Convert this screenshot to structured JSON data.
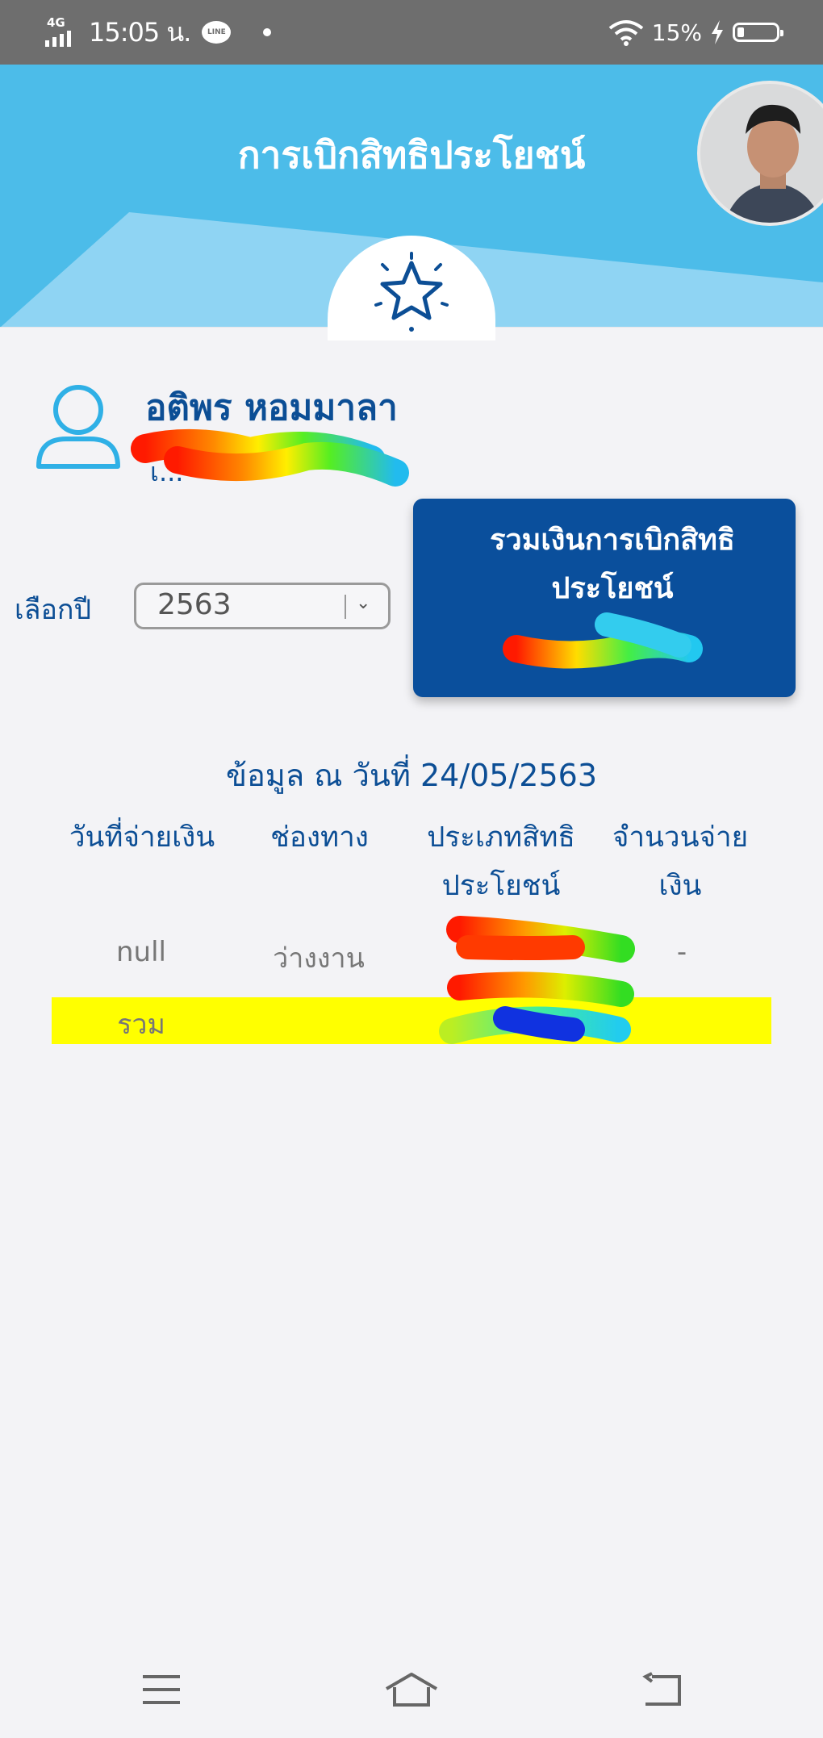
{
  "status_bar": {
    "network": "4G",
    "time": "15:05 น.",
    "line_badge": "LINE",
    "battery": "15%",
    "battery_level": 0.15
  },
  "header": {
    "title": "การเบิกสิทธิประโยชน์"
  },
  "profile": {
    "name": "อติพร หอมมาลา",
    "sub": "เ..."
  },
  "year_selector": {
    "label": "เลือกปี",
    "value": "2563"
  },
  "total_card": {
    "title": "รวมเงินการเบิกสิทธิประโยชน์",
    "value": "-"
  },
  "table": {
    "as_of": "ข้อมูล ณ วันที่ 24/05/2563",
    "headers": [
      "วันที่จ่ายเงิน",
      "ช่องทาง",
      "ประเภทสิทธิประโยชน์",
      "จำนวนจ่ายเงิน"
    ],
    "rows": [
      {
        "date": "null",
        "channel": "ว่างงาน",
        "type": "",
        "amount": "-"
      }
    ],
    "summary": {
      "label": "รวม",
      "amount": ""
    }
  },
  "colors": {
    "header_bg": "#4cbce9",
    "primary": "#0c4e95",
    "card_bg": "#0a4f9c",
    "summary_highlight": "#ffff00"
  },
  "icons": [
    "network-4g-icon",
    "line-icon",
    "wifi-icon",
    "charging-icon",
    "battery-icon",
    "star-icon",
    "user-icon",
    "chevron-down-icon",
    "menu-icon",
    "home-icon",
    "back-icon"
  ]
}
